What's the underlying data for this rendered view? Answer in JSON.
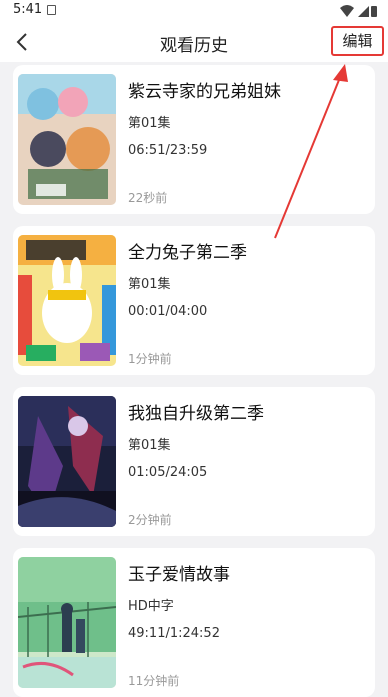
{
  "status_bar": {
    "time": "5:41"
  },
  "header": {
    "title": "观看历史",
    "edit_label": "编辑"
  },
  "history": [
    {
      "title": "紫云寺家的兄弟姐妹",
      "episode": "第01集",
      "progress": "06:51/23:59",
      "time_ago": "22秒前"
    },
    {
      "title": "全力兔子第二季",
      "episode": "第01集",
      "progress": "00:01/04:00",
      "time_ago": "1分钟前"
    },
    {
      "title": "我独自升级第二季",
      "episode": "第01集",
      "progress": "01:05/24:05",
      "time_ago": "2分钟前"
    },
    {
      "title": "玉子爱情故事",
      "episode": "HD中字",
      "progress": "49:11/1:24:52",
      "time_ago": "11分钟前"
    }
  ],
  "colors": {
    "highlight": "#e53935",
    "card_bg": "#ffffff",
    "page_bg": "#f2f2f4"
  }
}
